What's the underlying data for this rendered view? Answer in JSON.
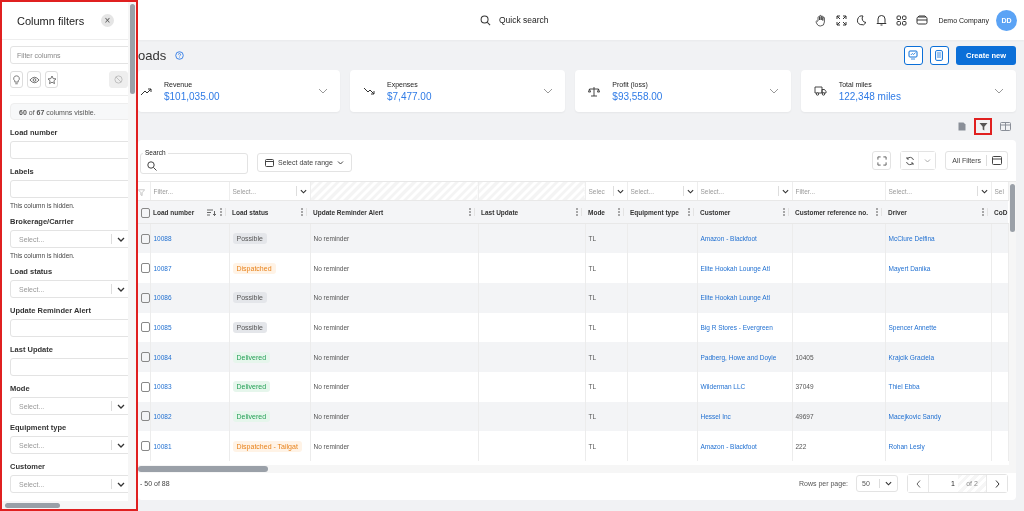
{
  "filter_panel": {
    "title": "Column filters",
    "close": "×",
    "search": {
      "placeholder": "Filter columns"
    },
    "summary": "**60** of **67** columns visible.",
    "fields": [
      {
        "label": "Load number",
        "kind": "text"
      },
      {
        "label": "Labels",
        "kind": "text",
        "note": "This column is hidden."
      },
      {
        "label": "Brokerage/Carrier",
        "kind": "select",
        "placeholder": "Select...",
        "note": "This column is hidden."
      },
      {
        "label": "Load status",
        "kind": "select",
        "placeholder": "Select..."
      },
      {
        "label": "Update Reminder Alert",
        "kind": "text"
      },
      {
        "label": "Last Update",
        "kind": "text"
      },
      {
        "label": "Mode",
        "kind": "select",
        "placeholder": "Select..."
      },
      {
        "label": "Equipment type",
        "kind": "select",
        "placeholder": "Select..."
      },
      {
        "label": "Customer",
        "kind": "select",
        "placeholder": "Select..."
      }
    ]
  },
  "header": {
    "quick_search": "Quick search",
    "company": "Demo Company",
    "avatar": "DD"
  },
  "page": {
    "title": "oads",
    "create_button": "Create new"
  },
  "stats": [
    {
      "kind": "revenue",
      "label": "Revenue",
      "value": "$101,035.00"
    },
    {
      "kind": "expenses",
      "label": "Expenses",
      "value": "$7,477.00"
    },
    {
      "kind": "profit",
      "label": "Profit (loss)",
      "value": "$93,558.00"
    },
    {
      "kind": "miles",
      "label": "Total miles",
      "value": "122,348 miles"
    }
  ],
  "toolbar": {
    "search_label": "Search",
    "date_range": "Select date range",
    "all_filters": "All Filters"
  },
  "table": {
    "all_checked": false,
    "columns": [
      {
        "label": "Load number",
        "kind": "text",
        "filter_text": "Filter...",
        "sortable": true
      },
      {
        "label": "Load status",
        "kind": "select",
        "filter_text": "Select..."
      },
      {
        "label": "Update Reminder Alert",
        "kind": "disabled"
      },
      {
        "label": "Last Update",
        "kind": "disabled"
      },
      {
        "label": "Mode",
        "kind": "select",
        "filter_text": "Selec"
      },
      {
        "label": "Equipment type",
        "kind": "select",
        "filter_text": "Select..."
      },
      {
        "label": "Customer",
        "kind": "select",
        "filter_text": "Select..."
      },
      {
        "label": "Customer reference no.",
        "kind": "text",
        "filter_text": "Filter..."
      },
      {
        "label": "Driver",
        "kind": "select",
        "filter_text": "Select..."
      },
      {
        "label": "CoD",
        "kind": "text",
        "filter_text": "Sel"
      }
    ],
    "rows": [
      {
        "checked": false,
        "number": "10088",
        "status": {
          "text": "Possible",
          "kind": "possible"
        },
        "reminder": "No reminder",
        "mode": "TL",
        "customer": "Amazon - Blackfoot",
        "driver": "McClure Delfina"
      },
      {
        "checked": false,
        "number": "10087",
        "status": {
          "text": "Dispatched",
          "kind": "dispatched"
        },
        "reminder": "No reminder",
        "mode": "TL",
        "customer": "Elite Hookah Lounge Atl",
        "driver": "Mayert Danika"
      },
      {
        "checked": false,
        "number": "10086",
        "status": {
          "text": "Possible",
          "kind": "possible"
        },
        "reminder": "No reminder",
        "mode": "TL",
        "customer": "Elite Hookah Lounge Atl"
      },
      {
        "checked": false,
        "number": "10085",
        "status": {
          "text": "Possible",
          "kind": "possible"
        },
        "reminder": "No reminder",
        "mode": "TL",
        "customer": "Big R Stores - Evergreen",
        "driver": "Spencer Annette"
      },
      {
        "checked": false,
        "number": "10084",
        "status": {
          "text": "Delivered",
          "kind": "delivered"
        },
        "reminder": "No reminder",
        "mode": "TL",
        "customer": "Padberg, Howe and Doyle",
        "reference": "10405",
        "driver": "Krajcik Graciela"
      },
      {
        "checked": false,
        "number": "10083",
        "status": {
          "text": "Delivered",
          "kind": "delivered"
        },
        "reminder": "No reminder",
        "mode": "TL",
        "customer": "Wilderman LLC",
        "reference": "37049",
        "driver": "Thiel Ebba"
      },
      {
        "checked": false,
        "number": "10082",
        "status": {
          "text": "Delivered",
          "kind": "delivered"
        },
        "reminder": "No reminder",
        "mode": "TL",
        "customer": "Hessel Inc",
        "reference": "49697",
        "driver": "Macejkovic Sandy"
      },
      {
        "checked": false,
        "number": "10081",
        "status": {
          "text": "Dispatched - Tailgat",
          "kind": "dispatched"
        },
        "reminder": "No reminder",
        "mode": "TL",
        "customer": "Amazon - Blackfoot",
        "reference": "222",
        "driver": "Rohan Lesly"
      }
    ]
  },
  "footer": {
    "range": "- 50 of 88",
    "rows_per_page_label": "Rows per page:",
    "rows_per_page": "50",
    "page": "1",
    "page_count": "of 2"
  }
}
